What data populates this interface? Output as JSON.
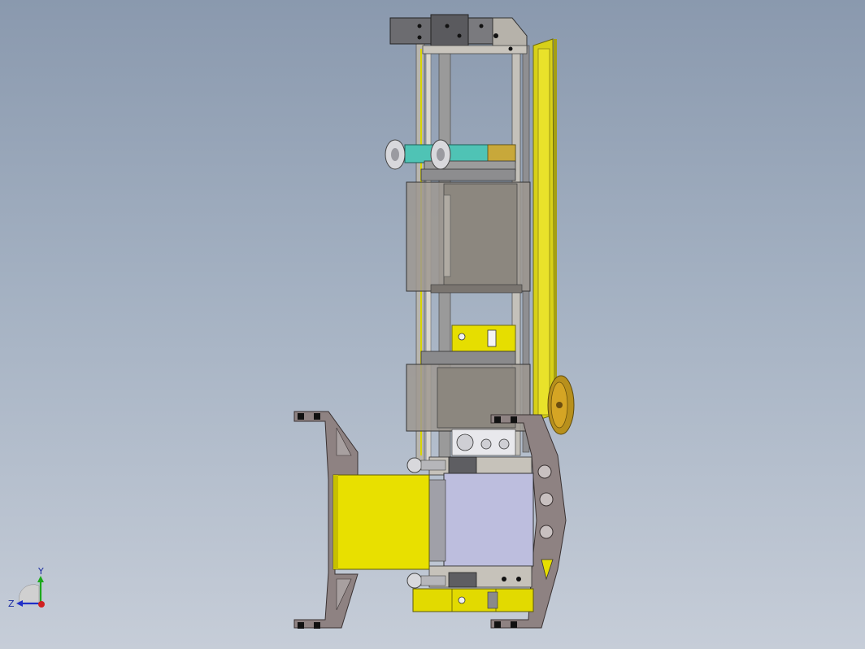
{
  "viewport": {
    "background_top": "#8a99ae",
    "background_bottom": "#c6cdd8"
  },
  "model": {
    "colors": {
      "yellow_plate": "#e8e000",
      "olive_edge": "#7d7a10",
      "grey_plate": "#b8b4ac",
      "dark_metal": "#5e5e62",
      "brown_frame": "#8a7d7d",
      "teal_part": "#3fb7a9",
      "lavender_block": "#bfbfdf",
      "bronze_disk": "#c89a1c"
    }
  },
  "triad": {
    "y_label": "Y",
    "z_label": "Z"
  }
}
